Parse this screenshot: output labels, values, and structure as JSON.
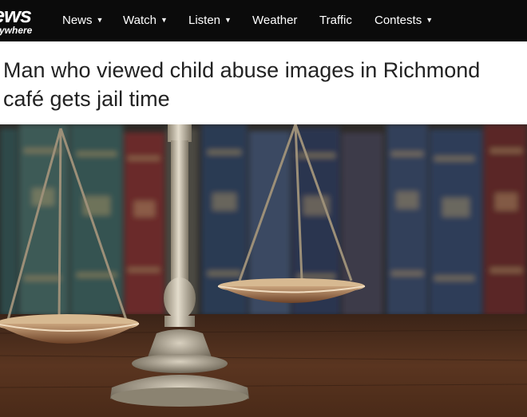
{
  "logo": {
    "main": "ews",
    "sub": "ywhere"
  },
  "nav": {
    "items": [
      {
        "label": "News",
        "dropdown": true
      },
      {
        "label": "Watch",
        "dropdown": true
      },
      {
        "label": "Listen",
        "dropdown": true
      },
      {
        "label": "Weather",
        "dropdown": false
      },
      {
        "label": "Traffic",
        "dropdown": false
      },
      {
        "label": "Contests",
        "dropdown": true
      }
    ],
    "caret_icon": "chevron-down-icon"
  },
  "article": {
    "headline": "Man who viewed child abuse images in Richmond café gets jail time",
    "hero_image_icon": "scales-of-justice-image"
  },
  "colors": {
    "nav_bg": "#0b0b0b",
    "nav_text": "#ffffff",
    "headline_text": "#222222"
  }
}
